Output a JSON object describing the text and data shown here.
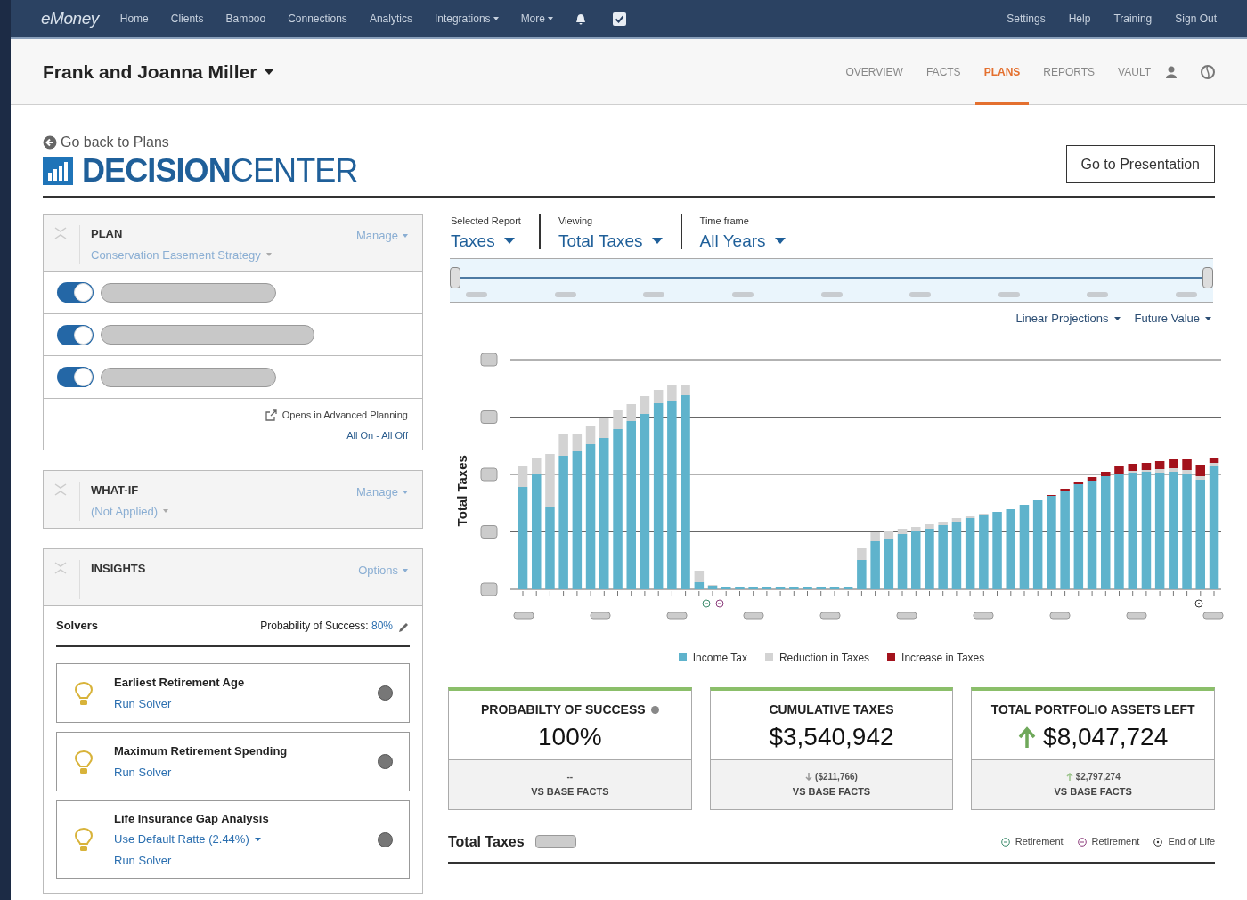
{
  "top_nav": {
    "logo": "eMoney",
    "items": [
      {
        "label": "Home",
        "dropdown": false
      },
      {
        "label": "Clients",
        "dropdown": false
      },
      {
        "label": "Bamboo",
        "dropdown": false
      },
      {
        "label": "Connections",
        "dropdown": false
      },
      {
        "label": "Analytics",
        "dropdown": false
      },
      {
        "label": "Integrations",
        "dropdown": true
      },
      {
        "label": "More",
        "dropdown": true
      }
    ],
    "right_items": [
      "Settings",
      "Help",
      "Training",
      "Sign Out"
    ]
  },
  "client_header": {
    "name": "Frank and Joanna Miller",
    "tabs": [
      {
        "label": "OVERVIEW",
        "selected": false
      },
      {
        "label": "FACTS",
        "selected": false
      },
      {
        "label": "PLANS",
        "selected": true
      },
      {
        "label": "REPORTS",
        "selected": false
      },
      {
        "label": "VAULT",
        "selected": false
      }
    ]
  },
  "back_link": "Go back to Plans",
  "title": {
    "bold": "DECISION",
    "light": "CENTER"
  },
  "presentation_button": "Go to Presentation",
  "plan_panel": {
    "heading": "PLAN",
    "plan_name": "Conservation Easement Strategy",
    "menu": "Manage",
    "toggles": [
      {
        "on": true
      },
      {
        "on": true
      },
      {
        "on": true
      }
    ],
    "note": "Opens in Advanced Planning",
    "all_toggle": "All On - All Off"
  },
  "whatif_panel": {
    "heading": "WHAT-IF",
    "value": "(Not Applied)",
    "menu": "Manage"
  },
  "insights_panel": {
    "heading": "INSIGHTS",
    "menu": "Options",
    "solvers_label": "Solvers",
    "probability_label": "Probability of Success:",
    "probability_value": "80%",
    "solvers": [
      {
        "title": "Earliest Retirement Age",
        "links": [
          "Run Solver"
        ]
      },
      {
        "title": "Maximum Retirement Spending",
        "links": [
          "Run Solver"
        ]
      },
      {
        "title": "Life Insurance Gap Analysis",
        "links": [
          "Use Default Ratte (2.44%)",
          "Run Solver"
        ]
      }
    ]
  },
  "selectors": [
    {
      "label": "Selected Report",
      "value": "Taxes"
    },
    {
      "label": "Viewing",
      "value": "Total Taxes"
    },
    {
      "label": "Time frame",
      "value": "All Years"
    }
  ],
  "timeline": {
    "level": 1
  },
  "chart_options": [
    "Linear Projections",
    "Future Value"
  ],
  "chart": {
    "ylabel": "Total Taxes",
    "legend": [
      {
        "label": "Income Tax",
        "color": "#5fb3cc"
      },
      {
        "label": "Reduction in Taxes",
        "color": "#d3d3d3"
      },
      {
        "label": "Increase in Taxes",
        "color": "#a3121c"
      }
    ]
  },
  "cards": [
    {
      "title": "PROBABILTY OF SUCCESS",
      "info_dot": true,
      "value": "100%",
      "delta": "--",
      "footer": "VS BASE FACTS"
    },
    {
      "title": "CUMULATIVE TAXES",
      "info_dot": false,
      "value": "$3,540,942",
      "delta_arrow_down": true,
      "delta": "($211,766)",
      "footer": "VS BASE FACTS"
    },
    {
      "title": "TOTAL PORTFOLIO ASSETS LEFT",
      "info_dot": false,
      "value_arrow_up": true,
      "value": "$8,047,724",
      "delta_arrow_up": true,
      "delta": "$2,797,274",
      "footer": "VS BASE FACTS"
    }
  ],
  "bottom": {
    "title": "Total Taxes",
    "markers": [
      {
        "kind": "retirement1",
        "label": "Retirement"
      },
      {
        "kind": "retirement2",
        "label": "Retirement"
      },
      {
        "kind": "end",
        "label": "End of Life"
      }
    ]
  }
}
